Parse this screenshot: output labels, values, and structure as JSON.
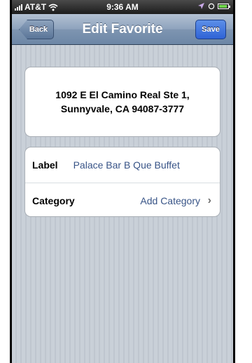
{
  "status_bar": {
    "carrier": "AT&T",
    "time": "9:36 AM"
  },
  "nav": {
    "back_label": "Back",
    "title": "Edit Favorite",
    "save_label": "Save"
  },
  "address": {
    "line1": "1092 E El Camino Real Ste 1,",
    "line2": "Sunnyvale, CA 94087-3777"
  },
  "fields": {
    "label": {
      "name": "Label",
      "value": "Palace Bar B Que Buffet"
    },
    "category": {
      "name": "Category",
      "value": "Add Category",
      "chevron": "›"
    }
  },
  "icons": {
    "signal": "signal-bars-icon",
    "wifi": "wifi-icon",
    "location": "location-arrow-icon",
    "alarm": "alarm-icon",
    "battery": "battery-icon"
  },
  "colors": {
    "nav_bar": "#7e95b1",
    "save_button": "#2f63d6",
    "value_text": "#385487",
    "background": "#c5ccd4"
  }
}
